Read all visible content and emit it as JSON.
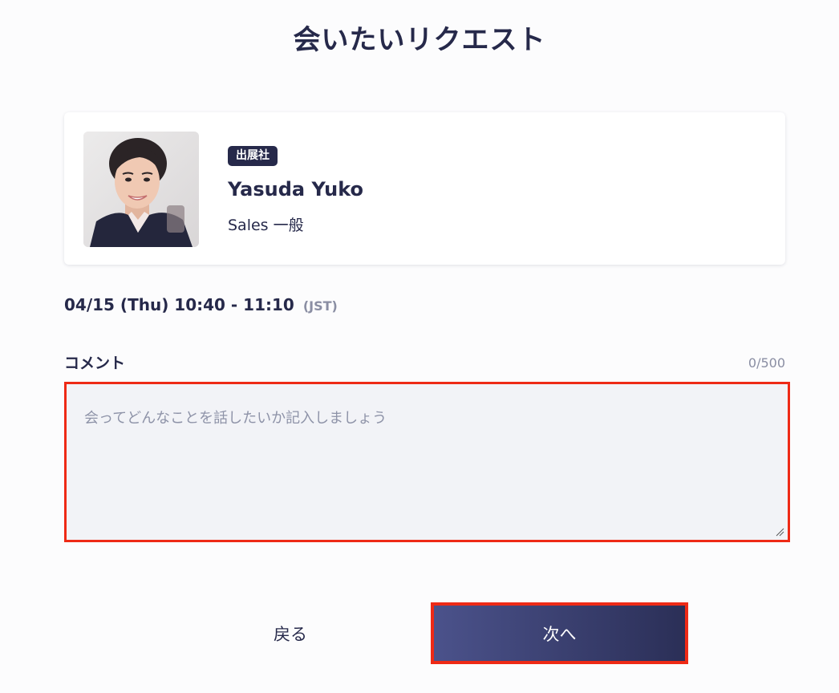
{
  "page": {
    "title": "会いたいリクエスト"
  },
  "profile": {
    "badge": "出展社",
    "name": "Yasuda Yuko",
    "role": "Sales 一般",
    "avatar_alt": "Yasuda Yuko"
  },
  "meeting": {
    "time": "04/15 (Thu) 10:40 - 11:10",
    "timezone": "(JST)"
  },
  "comment": {
    "label": "コメント",
    "counter": "0/500",
    "value": "",
    "placeholder": "会ってどんなことを話したいか記入しましょう"
  },
  "actions": {
    "back_label": "戻る",
    "next_label": "次へ"
  },
  "colors": {
    "primary_text": "#26294a",
    "muted_text": "#8a8ea3",
    "highlight_border": "#ee2a16",
    "button_gradient_start": "#4b528b",
    "button_gradient_end": "#2b2f57"
  }
}
